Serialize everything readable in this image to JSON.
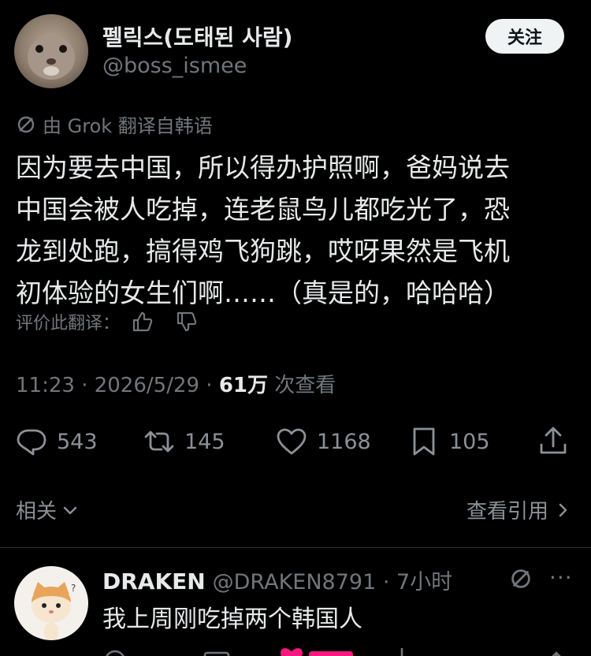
{
  "author": {
    "display_name": "펠릭스(도태된 사람)",
    "handle": "@boss_ismee",
    "follow_label": "关注"
  },
  "translation": {
    "notice": "由 Grok 翻译自韩语",
    "rate_label": "评价此翻译："
  },
  "tweet": {
    "lines": [
      "因为要去中国，所以得办护照啊，爸妈说去",
      "中国会被人吃掉，连老鼠鸟儿都吃光了，恐",
      "龙到处跑，搞得鸡飞狗跳，哎呀果然是飞机",
      "初体验的女生们啊……（真是的，哈哈哈）"
    ]
  },
  "meta": {
    "time_date": "11:23 · 2026/5/29 · ",
    "views_count": "61万",
    "views_label": " 次查看"
  },
  "actions": {
    "replies": "543",
    "retweets": "145",
    "likes": "1168",
    "bookmarks": "105"
  },
  "related": {
    "label": "相关",
    "quotes_label": "查看引用"
  },
  "reply": {
    "display_name": "DRAKEN",
    "handle_time": "@DRAKEN8791 · 7小时",
    "text": "我上周刚吃掉两个韩国人",
    "more": "···"
  }
}
